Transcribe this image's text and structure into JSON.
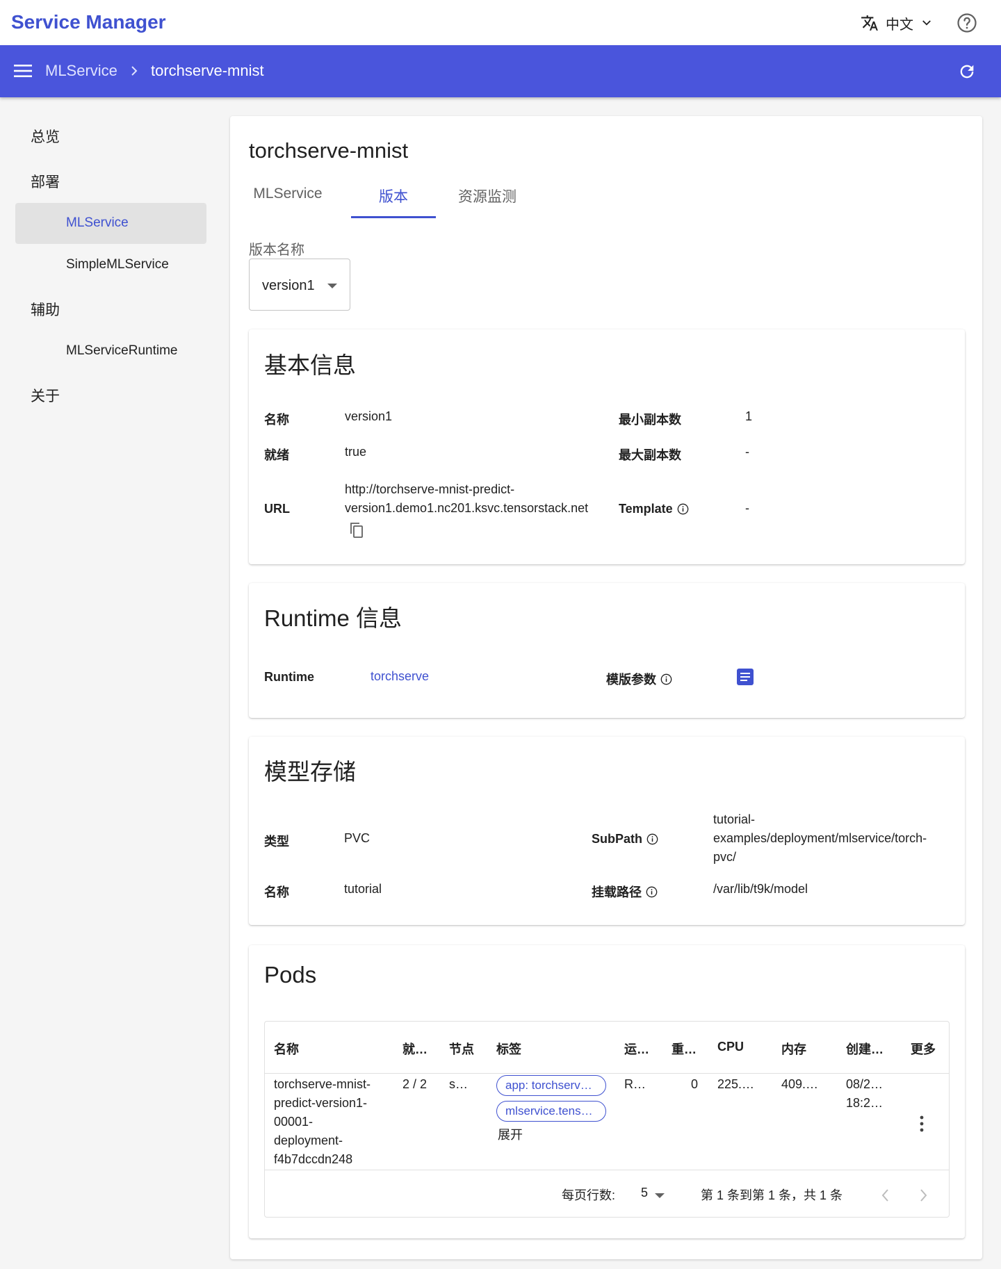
{
  "app": {
    "title": "Service Manager"
  },
  "header": {
    "language": "中文"
  },
  "breadcrumb": {
    "root": "MLService",
    "current": "torchserve-mnist"
  },
  "sidebar": {
    "sections": [
      {
        "label": "总览"
      },
      {
        "label": "部署",
        "items": [
          {
            "label": "MLService"
          },
          {
            "label": "SimpleMLService"
          }
        ]
      },
      {
        "label": "辅助",
        "items": [
          {
            "label": "MLServiceRuntime"
          }
        ]
      },
      {
        "label": "关于"
      }
    ],
    "active_item": "MLService"
  },
  "page": {
    "title": "torchserve-mnist",
    "tabs": [
      {
        "label": "MLService"
      },
      {
        "label": "版本"
      },
      {
        "label": "资源监测"
      }
    ],
    "active_tab": "版本",
    "version_select": {
      "label": "版本名称",
      "value": "version1"
    }
  },
  "basic_info": {
    "title": "基本信息",
    "name_label": "名称",
    "name_value": "version1",
    "ready_label": "就绪",
    "ready_value": "true",
    "url_label": "URL",
    "url_line1": "http://torchserve-mnist-predict-",
    "url_line2": "version1.demo1.nc201.ksvc.tensorstack.net",
    "min_replicas_label": "最小副本数",
    "min_replicas_value": "1",
    "max_replicas_label": "最大副本数",
    "max_replicas_value": "-",
    "template_label": "Template",
    "template_value": "-"
  },
  "runtime_info": {
    "title": "Runtime 信息",
    "runtime_label": "Runtime",
    "runtime_value": "torchserve",
    "params_label": "模版参数"
  },
  "storage": {
    "title": "模型存储",
    "type_label": "类型",
    "type_value": "PVC",
    "name_label": "名称",
    "name_value": "tutorial",
    "subpath_label": "SubPath",
    "subpath_line1": "tutorial-",
    "subpath_line2": "examples/deployment/mlservice/torch-",
    "subpath_line3": "pvc/",
    "mount_label": "挂载路径",
    "mount_value": "/var/lib/t9k/model"
  },
  "pods": {
    "title": "Pods",
    "columns": [
      "名称",
      "就…",
      "节点",
      "标签",
      "运…",
      "重…",
      "CPU",
      "内存",
      "创建…",
      "更多"
    ],
    "rows": [
      {
        "name_lines": [
          "torchserve-mnist-",
          "predict-version1-",
          "00001-",
          "deployment-",
          "f4b7dccdn248"
        ],
        "ready": "2 / 2",
        "node": "s…",
        "labels": [
          "app: torchserv…",
          "mlservice.tens…"
        ],
        "expand": "展开",
        "status": "R…",
        "restarts": "0",
        "cpu": "225.…",
        "memory": "409.…",
        "created_lines": [
          "08/2…",
          "18:2…"
        ]
      }
    ],
    "pagination": {
      "rows_per_page_label": "每页行数:",
      "rows_per_page": "5",
      "range": "第 1 条到第 1 条，共 1 条"
    }
  }
}
